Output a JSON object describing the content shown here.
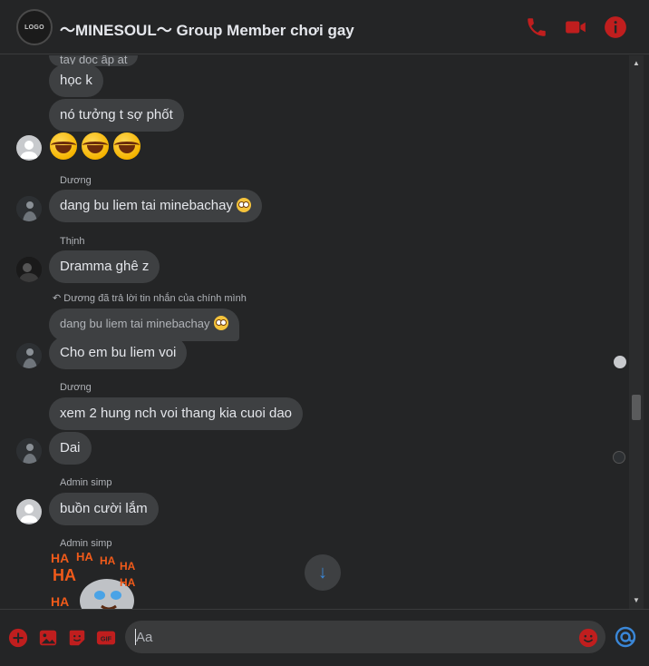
{
  "header": {
    "group_avatar_text": "LOGO",
    "title": "～MINESOUL～ Group Member chơi gay",
    "icons": [
      "phone-icon",
      "video-call-icon",
      "info-icon"
    ],
    "accent_color": "#c01e1e"
  },
  "messages": {
    "partial_top": "tạy dọc ấp at",
    "m1": "học k",
    "m2": "nó tưởng t sợ phốt",
    "sender_duong_1": "Dương",
    "m3": "dang bu liem tai minebachay",
    "sender_thinh": "Thịnh",
    "m4": "Dramma ghê z",
    "reply_note": "Dương đã trả lời tin nhắn của chính mình",
    "quoted": "dang bu liem tai minebachay",
    "m5": "Cho em bu liem voi",
    "sender_duong_2": "Dương",
    "m6": "xem 2 hung nch voi thang kia cuoi dao",
    "m7": "Dai",
    "sender_admin_1": "Admin simp",
    "m8": "buồn cười lắm",
    "sender_admin_2": "Admin simp",
    "sticker_text": "HA"
  },
  "composer": {
    "placeholder": "Aa",
    "icons": [
      "add-icon",
      "photo-icon",
      "sticker-icon",
      "gif-icon",
      "emoji-icon",
      "messenger-like-icon"
    ],
    "gif_label": "GIF"
  }
}
